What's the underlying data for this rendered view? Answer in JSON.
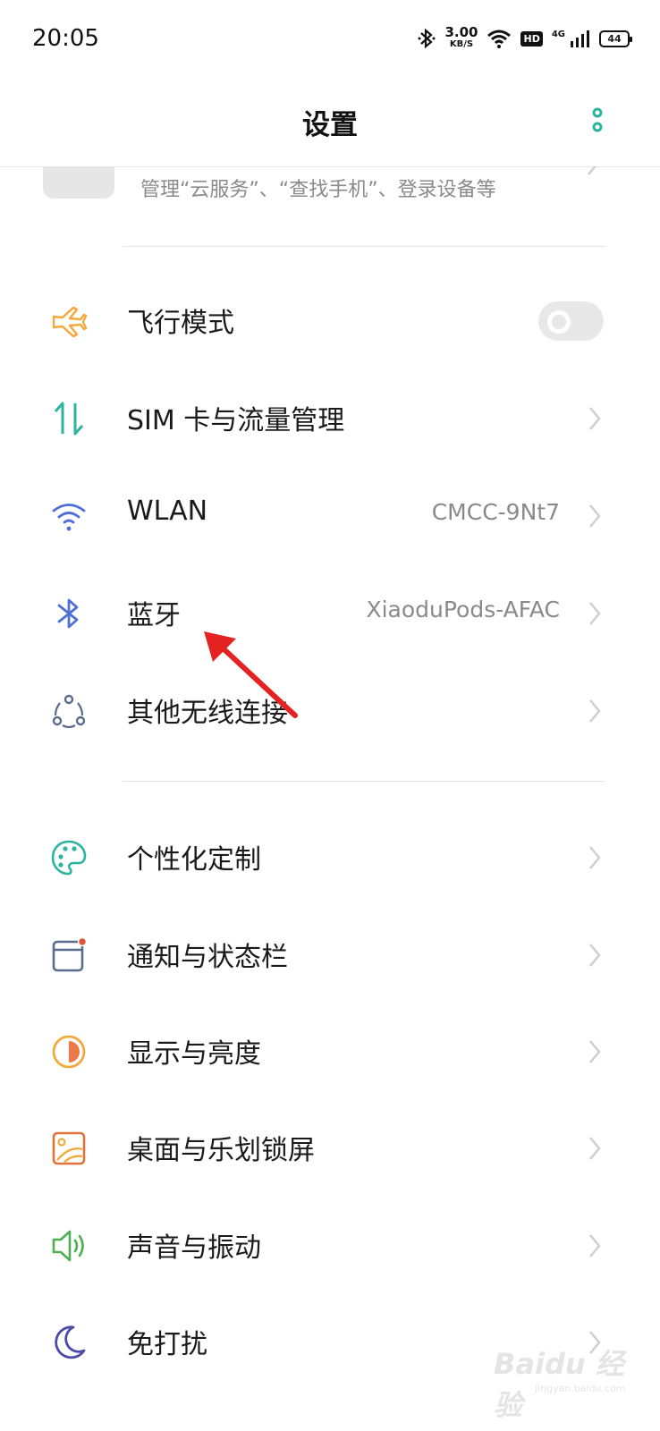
{
  "status_bar": {
    "time": "20:05",
    "net_speed": "3.00",
    "net_unit": "KB/S",
    "hd": "HD",
    "network": "4G",
    "battery": "44"
  },
  "header": {
    "title": "设置"
  },
  "cloud_item": {
    "subtitle": "管理“云服务”、“查找手机”、登录设备等"
  },
  "rows": [
    {
      "label": "飞行模式",
      "icon": "airplane-icon",
      "toggle": false
    },
    {
      "label": "SIM 卡与流量管理",
      "icon": "sim-data-icon"
    },
    {
      "label": "WLAN",
      "value": "CMCC-9Nt7",
      "icon": "wifi-icon"
    },
    {
      "label": "蓝牙",
      "value": "XiaoduPods-AFAC",
      "icon": "bluetooth-icon"
    },
    {
      "label": "其他无线连接",
      "icon": "wireless-connections-icon"
    },
    {
      "label": "个性化定制",
      "icon": "palette-icon"
    },
    {
      "label": "通知与状态栏",
      "icon": "notification-icon"
    },
    {
      "label": "显示与亮度",
      "icon": "brightness-icon"
    },
    {
      "label": "桌面与乐划锁屏",
      "icon": "wallpaper-icon"
    },
    {
      "label": "声音与振动",
      "icon": "sound-icon"
    },
    {
      "label": "免打扰",
      "icon": "moon-icon"
    }
  ],
  "watermark": {
    "text": "Baidu 经验",
    "sub": "jingyan.baidu.com"
  },
  "colors": {
    "airplane": "#f2a93b",
    "sim": "#2bb5a0",
    "wifi": "#4f6fd6",
    "bluetooth": "#4f6fd6",
    "palette": "#2bb5a0",
    "notification": "#5b6b8c",
    "brightness": "#f2a93b",
    "wallpaper": "#e2733a",
    "sound": "#4caf50",
    "moon": "#4b4aa8",
    "arrow": "#e52222"
  }
}
